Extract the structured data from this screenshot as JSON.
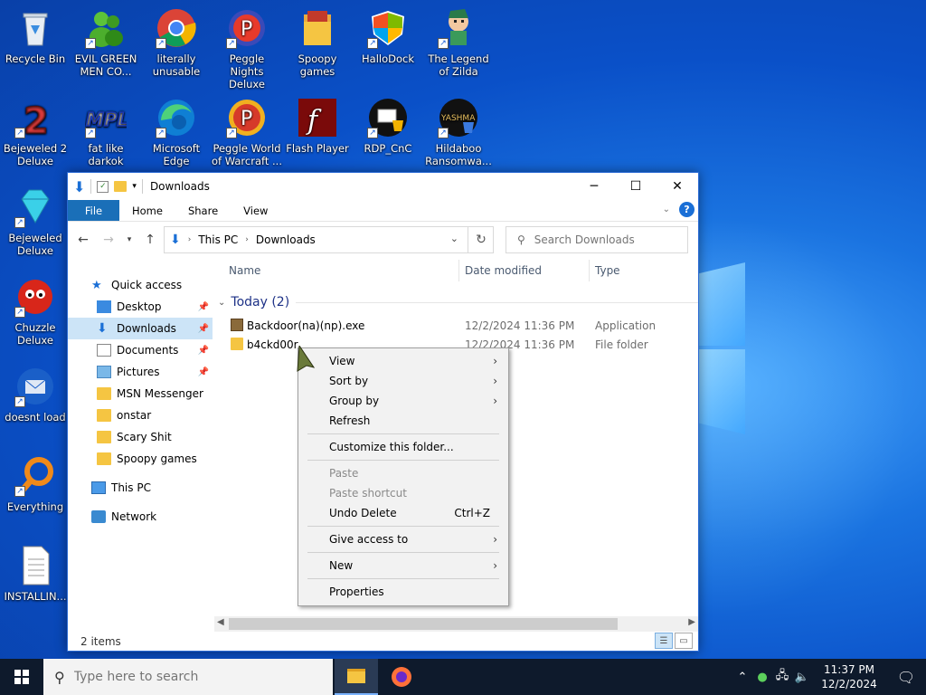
{
  "desktop": {
    "icons": [
      {
        "label": "Recycle Bin"
      },
      {
        "label": "EVIL GREEN MEN CO..."
      },
      {
        "label": "literally unusable"
      },
      {
        "label": "Peggle Nights Deluxe"
      },
      {
        "label": "Spoopy games"
      },
      {
        "label": "HalloDock"
      },
      {
        "label": "The Legend of Zilda"
      },
      {
        "label": "Bejeweled 2 Deluxe"
      },
      {
        "label": "fat like darkok"
      },
      {
        "label": "Microsoft Edge"
      },
      {
        "label": "Peggle World of Warcraft ..."
      },
      {
        "label": "Flash Player"
      },
      {
        "label": "RDP_CnC"
      },
      {
        "label": "Hildaboo Ransomwa..."
      },
      {
        "label": "Bejeweled Deluxe"
      },
      {
        "label": "Chuzzle Deluxe"
      },
      {
        "label": "doesnt load"
      },
      {
        "label": "Everything"
      },
      {
        "label": "INSTALLIN..."
      }
    ],
    "mpl_text": "MPL",
    "yashma_text": "YASHMA"
  },
  "explorer": {
    "title": "Downloads",
    "ribbon_tabs": [
      "File",
      "Home",
      "Share",
      "View"
    ],
    "help": "?",
    "address": {
      "root": "This PC",
      "current": "Downloads"
    },
    "search_placeholder": "Search Downloads",
    "columns": {
      "name": "Name",
      "date": "Date modified",
      "type": "Type"
    },
    "group_label": "Today (2)",
    "files": [
      {
        "name": "Backdoor(na)(np).exe",
        "date": "12/2/2024 11:36 PM",
        "type": "Application"
      },
      {
        "name": "b4ckd00r",
        "date": "12/2/2024 11:36 PM",
        "type": "File folder"
      }
    ],
    "nav": {
      "quick_access": "Quick access",
      "pinned": [
        "Desktop",
        "Downloads",
        "Documents",
        "Pictures"
      ],
      "folders": [
        "MSN Messenger",
        "onstar",
        "Scary Shit",
        "Spoopy games"
      ],
      "this_pc": "This PC",
      "network": "Network"
    },
    "status": "2 items"
  },
  "context_menu": {
    "view": "View",
    "sort_by": "Sort by",
    "group_by": "Group by",
    "refresh": "Refresh",
    "customize": "Customize this folder...",
    "paste": "Paste",
    "paste_shortcut": "Paste shortcut",
    "undo_delete": "Undo Delete",
    "undo_shortcut": "Ctrl+Z",
    "give_access": "Give access to",
    "new": "New",
    "properties": "Properties"
  },
  "taskbar": {
    "search_placeholder": "Type here to search",
    "time": "11:37 PM",
    "date": "12/2/2024"
  }
}
